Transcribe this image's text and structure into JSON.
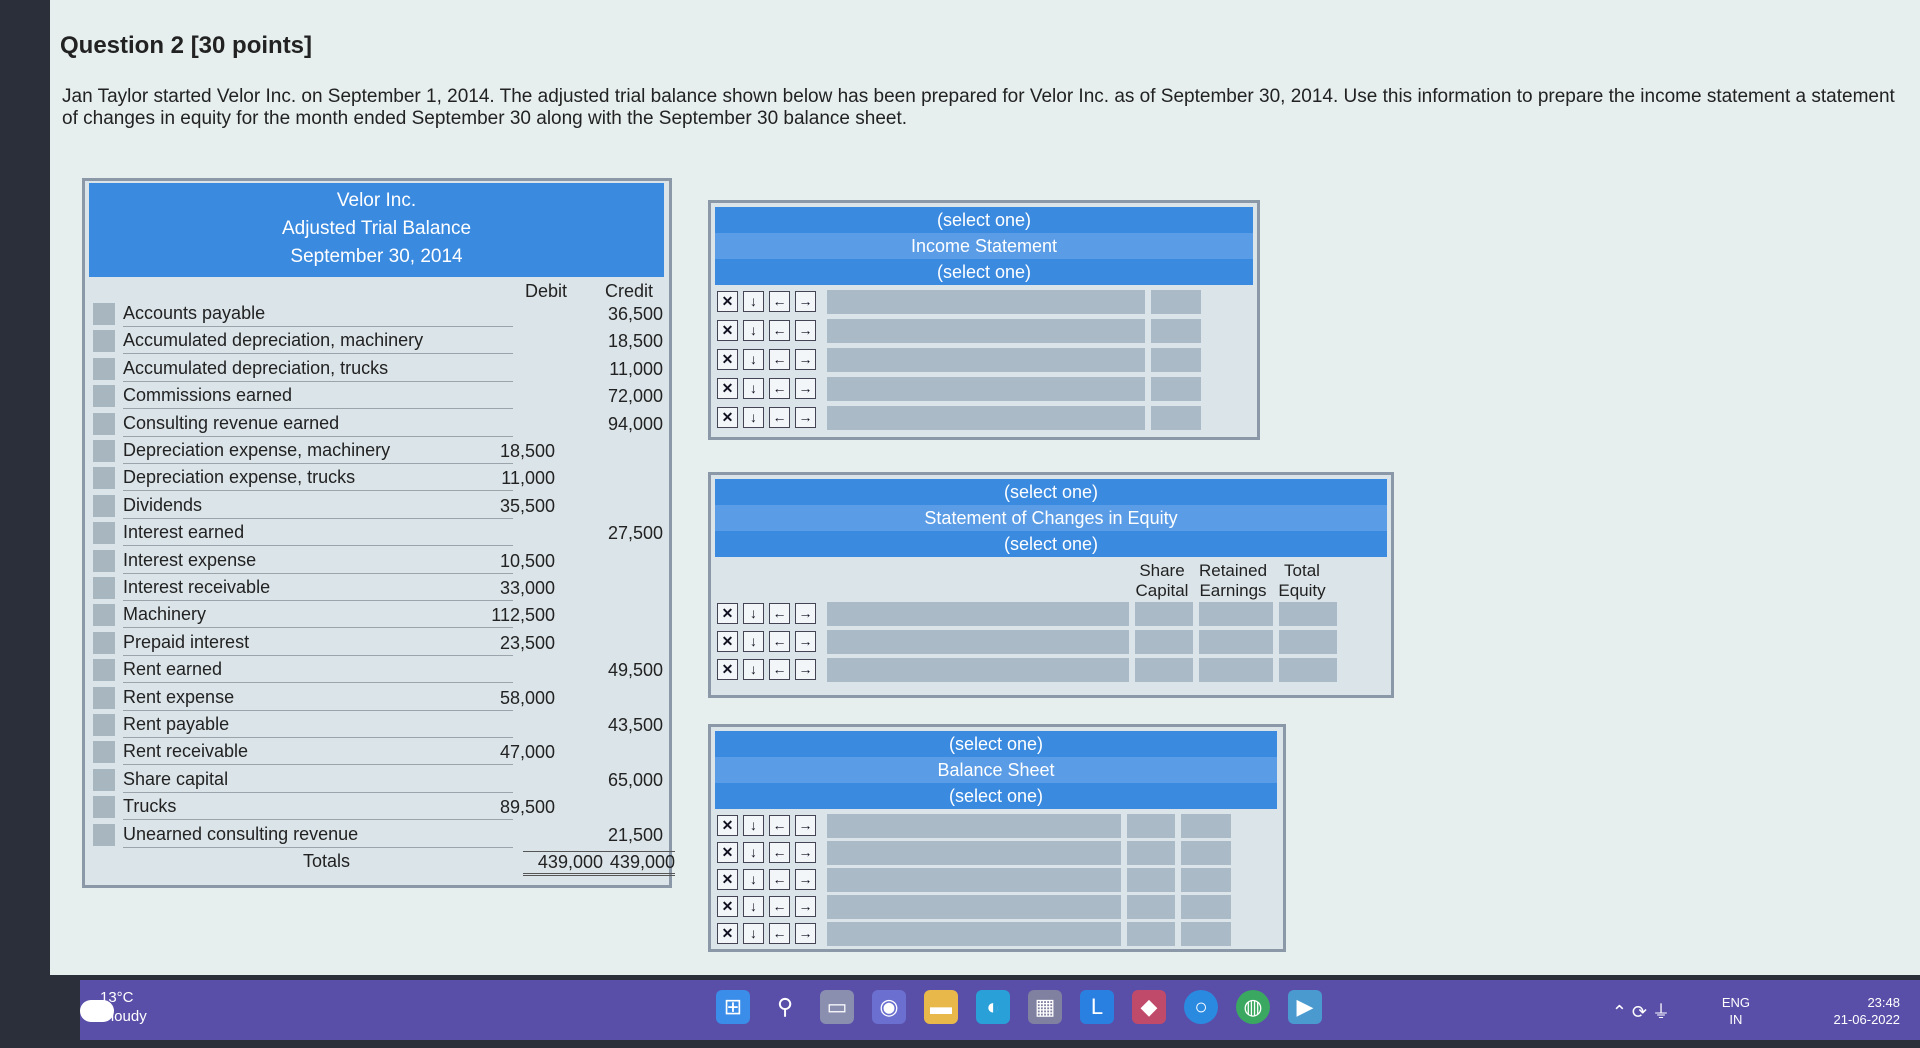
{
  "question": {
    "title": "Question 2 [30 points]",
    "intro": "Jan Taylor started Velor Inc. on September 1, 2014. The adjusted trial balance shown below has been prepared for Velor Inc. as of September 30, 2014. Use this information to prepare the income statement a statement of changes in equity for the month ended September 30 along with the September 30 balance sheet."
  },
  "trial_balance": {
    "company": "Velor Inc.",
    "title": "Adjusted Trial Balance",
    "date": "September 30, 2014",
    "debit_header": "Debit",
    "credit_header": "Credit",
    "rows": [
      {
        "account": "Accounts payable",
        "debit": "",
        "credit": "36,500"
      },
      {
        "account": "Accumulated depreciation, machinery",
        "debit": "",
        "credit": "18,500"
      },
      {
        "account": "Accumulated depreciation, trucks",
        "debit": "",
        "credit": "11,000"
      },
      {
        "account": "Commissions earned",
        "debit": "",
        "credit": "72,000"
      },
      {
        "account": "Consulting revenue earned",
        "debit": "",
        "credit": "94,000"
      },
      {
        "account": "Depreciation expense, machinery",
        "debit": "18,500",
        "credit": ""
      },
      {
        "account": "Depreciation expense, trucks",
        "debit": "11,000",
        "credit": ""
      },
      {
        "account": "Dividends",
        "debit": "35,500",
        "credit": ""
      },
      {
        "account": "Interest earned",
        "debit": "",
        "credit": "27,500"
      },
      {
        "account": "Interest expense",
        "debit": "10,500",
        "credit": ""
      },
      {
        "account": "Interest receivable",
        "debit": "33,000",
        "credit": ""
      },
      {
        "account": "Machinery",
        "debit": "112,500",
        "credit": ""
      },
      {
        "account": "Prepaid interest",
        "debit": "23,500",
        "credit": ""
      },
      {
        "account": "Rent earned",
        "debit": "",
        "credit": "49,500"
      },
      {
        "account": "Rent expense",
        "debit": "58,000",
        "credit": ""
      },
      {
        "account": "Rent payable",
        "debit": "",
        "credit": "43,500"
      },
      {
        "account": "Rent receivable",
        "debit": "47,000",
        "credit": ""
      },
      {
        "account": "Share capital",
        "debit": "",
        "credit": "65,000"
      },
      {
        "account": "Trucks",
        "debit": "89,500",
        "credit": ""
      },
      {
        "account": "Unearned consulting revenue",
        "debit": "",
        "credit": "21,500"
      }
    ],
    "totals_label": "Totals",
    "total_debit": "439,000",
    "total_credit": "439,000"
  },
  "income_statement": {
    "select_top": "(select one)",
    "title": "Income Statement",
    "select_bottom": "(select one)"
  },
  "equity_statement": {
    "select_top": "(select one)",
    "title": "Statement of Changes in Equity",
    "select_bottom": "(select one)",
    "col_share": [
      "Share",
      "Capital"
    ],
    "col_retained": [
      "Retained",
      "Earnings"
    ],
    "col_total": [
      "Total",
      "Equity"
    ]
  },
  "balance_sheet": {
    "select_top": "(select one)",
    "title": "Balance Sheet",
    "select_bottom": "(select one)"
  },
  "row_controls": {
    "delete": "✕",
    "insert_below": "↓",
    "outdent": "←",
    "indent": "→"
  },
  "taskbar": {
    "temperature": "13°C",
    "weather": "Cloudy",
    "language": "ENG",
    "region": "IN",
    "time": "23:48",
    "date": "21-06-2022"
  }
}
